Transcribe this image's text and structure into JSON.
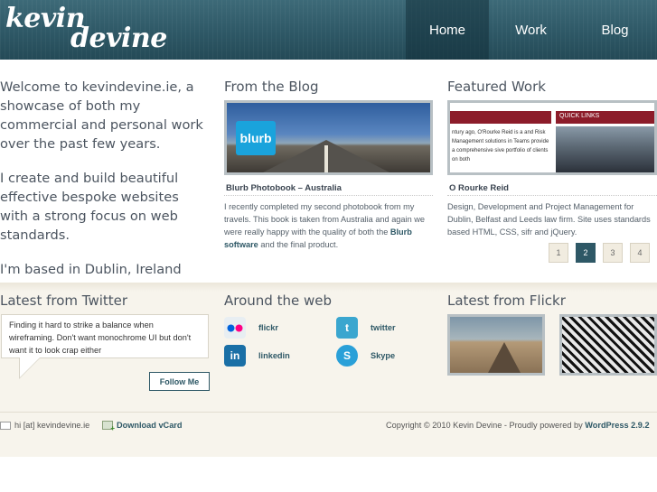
{
  "header": {
    "logo_line1": "kevin",
    "logo_line2": "devine",
    "nav": [
      {
        "label": "Home"
      },
      {
        "label": "Work"
      },
      {
        "label": "Blog"
      }
    ]
  },
  "intro": {
    "p1": "Welcome to kevindevine.ie, a showcase of both my commercial and personal work over the past few years.",
    "p2": "I create and build beautiful effective bespoke websites with a strong focus on web standards.",
    "p3": "I'm based in Dublin, Ireland"
  },
  "blog": {
    "title": "From the Blog",
    "badge": "blurb",
    "post_title": "Blurb Photobook – Australia",
    "body_1": "I recently completed my second photobook from my travels. This book is taken from Australia and again we were really happy with the quality of both the ",
    "body_link": "Blurb software",
    "body_2": " and the final product."
  },
  "work": {
    "title": "Featured Work",
    "quick_links": "QUICK LINKS",
    "preview_text": "ntury ago, O'Rourke Reid is a and Risk Management solutions in Teams provide a comprehensive sive portfolio of clients on both",
    "post_title": "O Rourke Reid",
    "body": "Design, Development and Project Management for Dublin, Belfast and Leeds law firm. Site uses standards based HTML, CSS, sifr and jQuery.",
    "pages": [
      "1",
      "2",
      "3",
      "4"
    ],
    "active_page": "2"
  },
  "twitter": {
    "title": "Latest from Twitter",
    "tweet": "Finding it hard to strike a balance when wireframing. Don't want monochrome UI but don't want it to look crap either",
    "follow": "Follow Me"
  },
  "web": {
    "title": "Around the web",
    "links": [
      {
        "label": "flickr",
        "icon": "flickr-icon",
        "color": "#e8eef2"
      },
      {
        "label": "twitter",
        "icon": "twitter-icon",
        "color": "#3aa6cf"
      },
      {
        "label": "linkedin",
        "icon": "linkedin-icon",
        "color": "#1a6fa6"
      },
      {
        "label": "Skype",
        "icon": "skype-icon",
        "color": "#2aa0d8"
      }
    ]
  },
  "flickr": {
    "title": "Latest from Flickr"
  },
  "footer": {
    "email": "hi [at] kevindevine.ie",
    "vcard": "Download vCard",
    "copyright": "Copyright © 2010 Kevin Devine - Proudly powered by ",
    "powered": "WordPress 2.9.2"
  }
}
